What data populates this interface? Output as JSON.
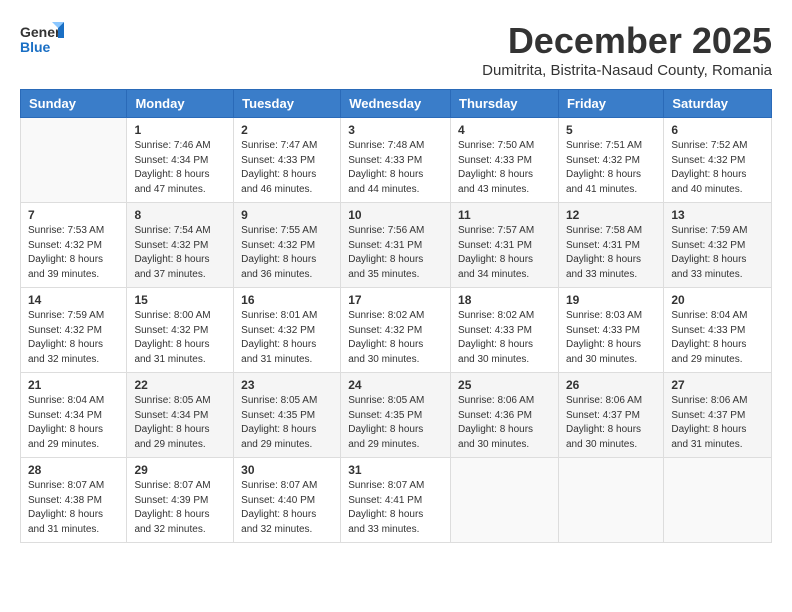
{
  "header": {
    "logo_general": "General",
    "logo_blue": "Blue",
    "month": "December 2025",
    "location": "Dumitrita, Bistrita-Nasaud County, Romania"
  },
  "weekdays": [
    "Sunday",
    "Monday",
    "Tuesday",
    "Wednesday",
    "Thursday",
    "Friday",
    "Saturday"
  ],
  "weeks": [
    [
      {
        "day": "",
        "info": ""
      },
      {
        "day": "1",
        "info": "Sunrise: 7:46 AM\nSunset: 4:34 PM\nDaylight: 8 hours\nand 47 minutes."
      },
      {
        "day": "2",
        "info": "Sunrise: 7:47 AM\nSunset: 4:33 PM\nDaylight: 8 hours\nand 46 minutes."
      },
      {
        "day": "3",
        "info": "Sunrise: 7:48 AM\nSunset: 4:33 PM\nDaylight: 8 hours\nand 44 minutes."
      },
      {
        "day": "4",
        "info": "Sunrise: 7:50 AM\nSunset: 4:33 PM\nDaylight: 8 hours\nand 43 minutes."
      },
      {
        "day": "5",
        "info": "Sunrise: 7:51 AM\nSunset: 4:32 PM\nDaylight: 8 hours\nand 41 minutes."
      },
      {
        "day": "6",
        "info": "Sunrise: 7:52 AM\nSunset: 4:32 PM\nDaylight: 8 hours\nand 40 minutes."
      }
    ],
    [
      {
        "day": "7",
        "info": "Sunrise: 7:53 AM\nSunset: 4:32 PM\nDaylight: 8 hours\nand 39 minutes."
      },
      {
        "day": "8",
        "info": "Sunrise: 7:54 AM\nSunset: 4:32 PM\nDaylight: 8 hours\nand 37 minutes."
      },
      {
        "day": "9",
        "info": "Sunrise: 7:55 AM\nSunset: 4:32 PM\nDaylight: 8 hours\nand 36 minutes."
      },
      {
        "day": "10",
        "info": "Sunrise: 7:56 AM\nSunset: 4:31 PM\nDaylight: 8 hours\nand 35 minutes."
      },
      {
        "day": "11",
        "info": "Sunrise: 7:57 AM\nSunset: 4:31 PM\nDaylight: 8 hours\nand 34 minutes."
      },
      {
        "day": "12",
        "info": "Sunrise: 7:58 AM\nSunset: 4:31 PM\nDaylight: 8 hours\nand 33 minutes."
      },
      {
        "day": "13",
        "info": "Sunrise: 7:59 AM\nSunset: 4:32 PM\nDaylight: 8 hours\nand 33 minutes."
      }
    ],
    [
      {
        "day": "14",
        "info": "Sunrise: 7:59 AM\nSunset: 4:32 PM\nDaylight: 8 hours\nand 32 minutes."
      },
      {
        "day": "15",
        "info": "Sunrise: 8:00 AM\nSunset: 4:32 PM\nDaylight: 8 hours\nand 31 minutes."
      },
      {
        "day": "16",
        "info": "Sunrise: 8:01 AM\nSunset: 4:32 PM\nDaylight: 8 hours\nand 31 minutes."
      },
      {
        "day": "17",
        "info": "Sunrise: 8:02 AM\nSunset: 4:32 PM\nDaylight: 8 hours\nand 30 minutes."
      },
      {
        "day": "18",
        "info": "Sunrise: 8:02 AM\nSunset: 4:33 PM\nDaylight: 8 hours\nand 30 minutes."
      },
      {
        "day": "19",
        "info": "Sunrise: 8:03 AM\nSunset: 4:33 PM\nDaylight: 8 hours\nand 30 minutes."
      },
      {
        "day": "20",
        "info": "Sunrise: 8:04 AM\nSunset: 4:33 PM\nDaylight: 8 hours\nand 29 minutes."
      }
    ],
    [
      {
        "day": "21",
        "info": "Sunrise: 8:04 AM\nSunset: 4:34 PM\nDaylight: 8 hours\nand 29 minutes."
      },
      {
        "day": "22",
        "info": "Sunrise: 8:05 AM\nSunset: 4:34 PM\nDaylight: 8 hours\nand 29 minutes."
      },
      {
        "day": "23",
        "info": "Sunrise: 8:05 AM\nSunset: 4:35 PM\nDaylight: 8 hours\nand 29 minutes."
      },
      {
        "day": "24",
        "info": "Sunrise: 8:05 AM\nSunset: 4:35 PM\nDaylight: 8 hours\nand 29 minutes."
      },
      {
        "day": "25",
        "info": "Sunrise: 8:06 AM\nSunset: 4:36 PM\nDaylight: 8 hours\nand 30 minutes."
      },
      {
        "day": "26",
        "info": "Sunrise: 8:06 AM\nSunset: 4:37 PM\nDaylight: 8 hours\nand 30 minutes."
      },
      {
        "day": "27",
        "info": "Sunrise: 8:06 AM\nSunset: 4:37 PM\nDaylight: 8 hours\nand 31 minutes."
      }
    ],
    [
      {
        "day": "28",
        "info": "Sunrise: 8:07 AM\nSunset: 4:38 PM\nDaylight: 8 hours\nand 31 minutes."
      },
      {
        "day": "29",
        "info": "Sunrise: 8:07 AM\nSunset: 4:39 PM\nDaylight: 8 hours\nand 32 minutes."
      },
      {
        "day": "30",
        "info": "Sunrise: 8:07 AM\nSunset: 4:40 PM\nDaylight: 8 hours\nand 32 minutes."
      },
      {
        "day": "31",
        "info": "Sunrise: 8:07 AM\nSunset: 4:41 PM\nDaylight: 8 hours\nand 33 minutes."
      },
      {
        "day": "",
        "info": ""
      },
      {
        "day": "",
        "info": ""
      },
      {
        "day": "",
        "info": ""
      }
    ]
  ]
}
